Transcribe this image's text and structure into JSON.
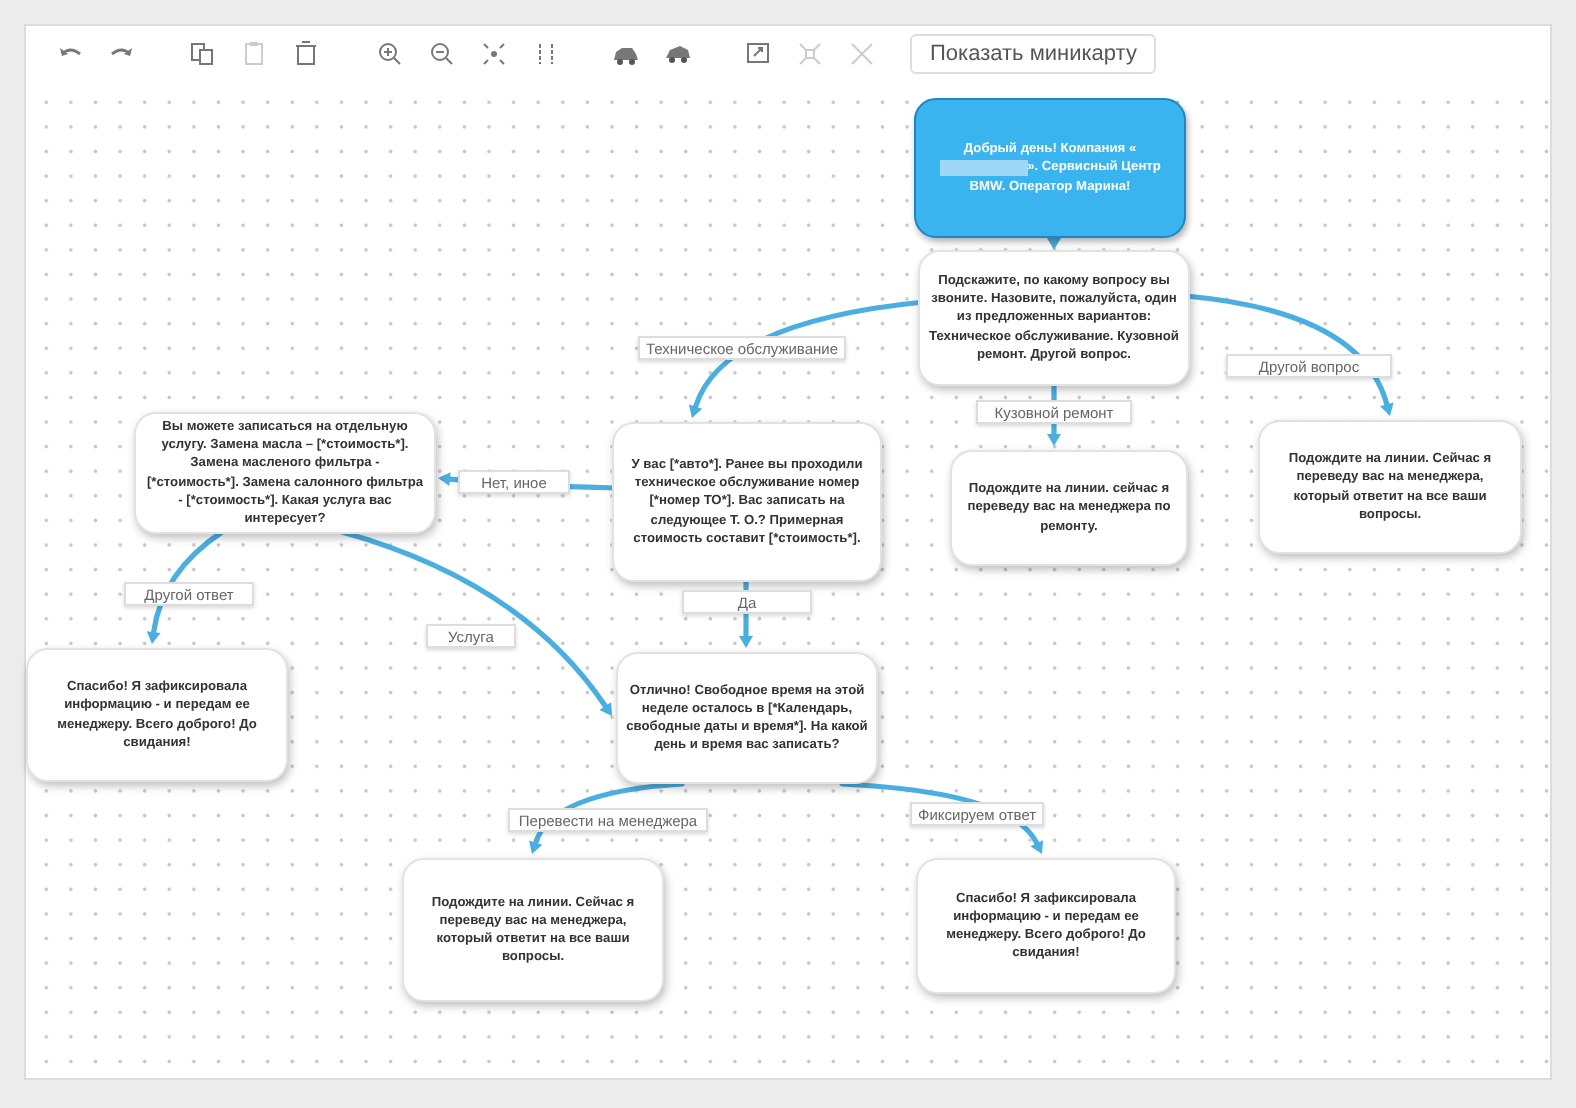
{
  "toolbar": {
    "tools": [
      {
        "kind": "undo",
        "disabled": false
      },
      {
        "kind": "redo",
        "disabled": false
      },
      {
        "kind": "copy",
        "disabled": false
      },
      {
        "kind": "paste",
        "disabled": true
      },
      {
        "kind": "delete",
        "disabled": false
      },
      {
        "kind": "zoom_in",
        "disabled": false
      },
      {
        "kind": "zoom_out",
        "disabled": false
      },
      {
        "kind": "fit",
        "disabled": false
      },
      {
        "kind": "columns",
        "disabled": false
      },
      {
        "kind": "car",
        "disabled": false
      },
      {
        "kind": "car_alt",
        "disabled": false
      },
      {
        "kind": "export",
        "disabled": false
      },
      {
        "kind": "collapse",
        "disabled": true
      },
      {
        "kind": "expand",
        "disabled": true
      }
    ],
    "minimap_button": "Показать миникарту"
  },
  "diagram": {
    "nodes": [
      {
        "kind": "start",
        "text": "Добрый день! Компания «",
        "text_after": "». Сервисный Центр BMW. Оператор Марина!"
      },
      {
        "kind": "message",
        "text": "Подскажите, по какому вопросу вы звоните. Назовите, пожалуйста, один из предложенных вариантов: Техническое обслуживание. Кузовной ремонт. Другой вопрос."
      },
      {
        "kind": "message",
        "text": "Вы можете записаться на отдельную услугу. Замена масла – [*стоимость*]. Замена масленого фильтра - [*стоимость*]. Замена салонного фильтра - [*стоимость*]. Какая услуга вас интересует?"
      },
      {
        "kind": "message",
        "text": "У вас [*авто*]. Ранее вы проходили техническое обслуживание номер [*номер ТО*]. Вас  записать на следующее Т. О.? Примерная стоимость составит [*стоимость*]."
      },
      {
        "kind": "message",
        "text": "Подождите на линии. сейчас я переведу вас на менеджера по ремонту."
      },
      {
        "kind": "message",
        "text": "Подождите на линии. Сейчас я переведу вас на менеджера, который ответит на все ваши вопросы."
      },
      {
        "kind": "message",
        "text": "Спасибо! Я зафиксировала информацию  - и передам ее менеджеру. Всего доброго! До свидания!"
      },
      {
        "kind": "message",
        "text": "Отлично! Свободное время на этой неделе осталось в [*Календарь, свободные даты и время*]. На какой день и время вас записать?"
      },
      {
        "kind": "message",
        "text": "Подождите на линии. Сейчас я переведу вас на менеджера, который ответит на все ваши вопросы."
      },
      {
        "kind": "message",
        "text": "Спасибо! Я зафиксировала информацию  - и передам ее менеджеру. Всего доброго! До свидания!"
      }
    ],
    "edges": [
      {
        "kind": "plain"
      },
      {
        "kind": "labelled",
        "label": "Техническое обслуживание"
      },
      {
        "kind": "labelled",
        "label": "Кузовной ремонт"
      },
      {
        "kind": "labelled",
        "label": "Другой вопрос"
      },
      {
        "kind": "labelled",
        "label": "Нет, иное"
      },
      {
        "kind": "labelled",
        "label": "Да"
      },
      {
        "kind": "labelled",
        "label": "Другой ответ"
      },
      {
        "kind": "labelled",
        "label": "Услуга"
      },
      {
        "kind": "labelled",
        "label": "Перевести на менеджера"
      },
      {
        "kind": "labelled",
        "label": "Фиксируем ответ"
      }
    ]
  }
}
